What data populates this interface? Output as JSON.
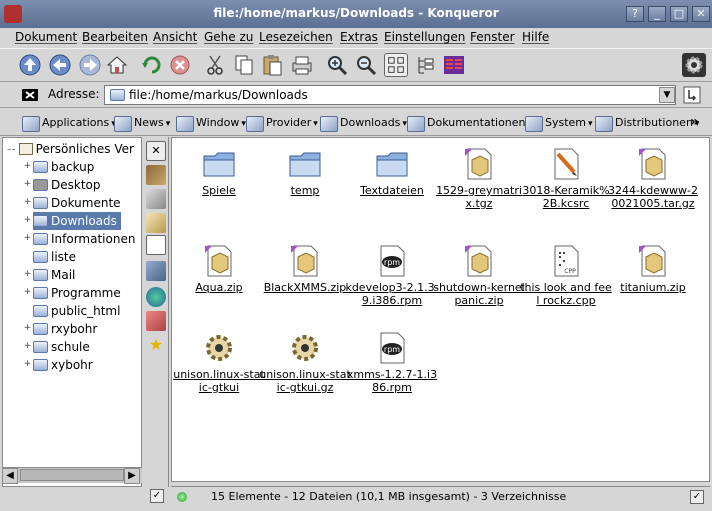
{
  "window": {
    "title": "file:/home/markus/Downloads - Konqueror",
    "buttons": [
      "?",
      "_",
      "□",
      "✕"
    ]
  },
  "menubar": {
    "items": [
      "Dokument",
      "Bearbeiten",
      "Ansicht",
      "Gehe zu",
      "Lesezeichen",
      "Extras",
      "Einstellungen",
      "Fenster",
      "Hilfe"
    ]
  },
  "toolbar": {
    "icons": [
      "up-arrow-icon",
      "back-arrow-icon",
      "forward-arrow-icon",
      "home-icon",
      "reload-icon",
      "stop-icon",
      "cut-icon",
      "copy-icon",
      "paste-icon",
      "print-icon",
      "zoom-in-icon",
      "zoom-out-icon",
      "icon-view-icon",
      "tree-view-icon",
      "multicolumn-view-icon"
    ]
  },
  "location": {
    "label": "Adresse:",
    "value": "file:/home/markus/Downloads"
  },
  "bookmarks": {
    "items": [
      "Applications",
      "News",
      "Window",
      "Provider",
      "Downloads",
      "Dokumentationen",
      "System",
      "Distributionen"
    ],
    "more": "»"
  },
  "sidebar": {
    "root": "Persönliches Ver",
    "items": [
      "backup",
      "Desktop",
      "Dokumente",
      "Downloads",
      "Informationen",
      "liste",
      "Mail",
      "Programme",
      "public_html",
      "rxybohr",
      "schule",
      "xybohr"
    ],
    "selected": "Downloads"
  },
  "files": [
    {
      "name": "Spiele",
      "type": "folder"
    },
    {
      "name": "temp",
      "type": "folder"
    },
    {
      "name": "Textdateien",
      "type": "folder"
    },
    {
      "name": "1529-greymatrix.tgz",
      "type": "archive"
    },
    {
      "name": "3018-Keramik%2B.kcsrc",
      "type": "kcsrc"
    },
    {
      "name": "3244-kdewww-20021005.tar.gz",
      "type": "archive"
    },
    {
      "name": "Aqua.zip",
      "type": "archive"
    },
    {
      "name": "BlackXMMS.zip",
      "type": "archive"
    },
    {
      "name": "kdevelop3-2.1.3-9.i386.rpm",
      "type": "rpm"
    },
    {
      "name": "shutdown-kernel panic.zip",
      "type": "archive"
    },
    {
      "name": "this look and feel rockz.cpp",
      "type": "cpp"
    },
    {
      "name": "titanium.zip",
      "type": "archive"
    },
    {
      "name": "unison.linux-static-gtkui",
      "type": "executable"
    },
    {
      "name": "unison.linux-static-gtkui.gz",
      "type": "executable"
    },
    {
      "name": "xmms-1.2.7-1.i386.rpm",
      "type": "rpm"
    }
  ],
  "status": {
    "text": "15 Elemente - 12 Dateien (10,1 MB insgesamt) - 3 Verzeichnisse"
  }
}
